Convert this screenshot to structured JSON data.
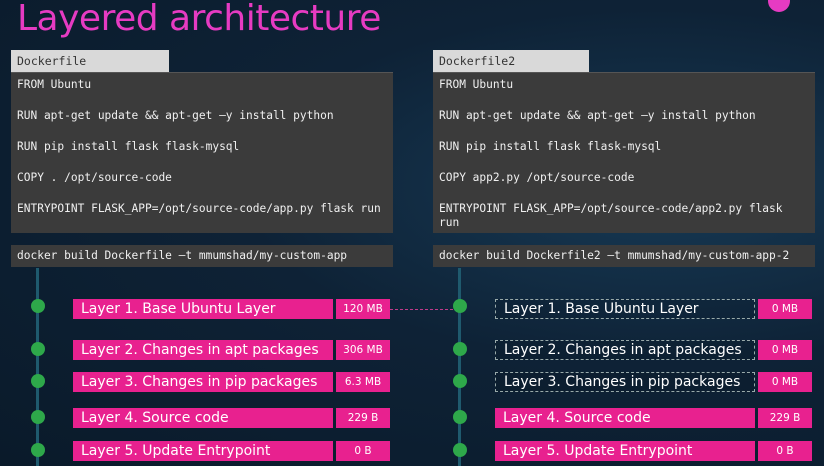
{
  "title": "Layered architecture",
  "colors": {
    "accent": "#e63bc2",
    "layer_fill": "#e8218f",
    "node": "#2ea84a",
    "code_bg": "#3b3b3b"
  },
  "left": {
    "tab_label": "Dockerfile",
    "code_lines": [
      "FROM Ubuntu",
      "RUN apt-get update && apt-get –y install python",
      "RUN pip install flask flask-mysql",
      "COPY . /opt/source-code",
      "ENTRYPOINT FLASK_APP=/opt/source-code/app.py flask run"
    ],
    "build_command": "docker build Dockerfile –t mmumshad/my-custom-app",
    "layers": [
      {
        "name": "Layer 1. Base Ubuntu Layer",
        "size": "120 MB"
      },
      {
        "name": "Layer 2. Changes in apt packages",
        "size": "306 MB"
      },
      {
        "name": "Layer 3. Changes in pip packages",
        "size": "6.3 MB"
      },
      {
        "name": "Layer 4. Source code",
        "size": "229 B"
      },
      {
        "name": "Layer 5. Update Entrypoint",
        "size": "0 B"
      }
    ]
  },
  "right": {
    "tab_label": "Dockerfile2",
    "code_lines": [
      "FROM Ubuntu",
      "RUN apt-get update && apt-get –y install python",
      "RUN pip install flask flask-mysql",
      "COPY app2.py /opt/source-code",
      "ENTRYPOINT FLASK_APP=/opt/source-code/app2.py flask run"
    ],
    "build_command": "docker build Dockerfile2 –t mmumshad/my-custom-app-2",
    "layers": [
      {
        "name": "Layer 1. Base Ubuntu Layer",
        "size": "0 MB"
      },
      {
        "name": "Layer 2. Changes in apt packages",
        "size": "0 MB"
      },
      {
        "name": "Layer 3. Changes in pip packages",
        "size": "0 MB"
      },
      {
        "name": "Layer 4. Source code",
        "size": "229 B"
      },
      {
        "name": "Layer 5. Update Entrypoint",
        "size": "0 B"
      }
    ]
  }
}
